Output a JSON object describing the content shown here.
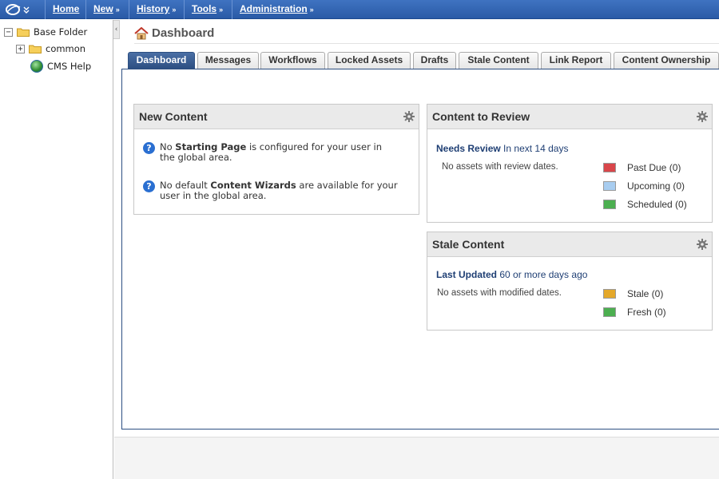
{
  "topbar": {
    "menu": [
      {
        "label": "Home",
        "chevron": false
      },
      {
        "label": "New",
        "chevron": true
      },
      {
        "label": "History",
        "chevron": true
      },
      {
        "label": "Tools",
        "chevron": true
      },
      {
        "label": "Administration",
        "chevron": true
      }
    ]
  },
  "sidebar": {
    "items": [
      {
        "label": "Base Folder",
        "toggle": "−",
        "icon": "folder-icon"
      },
      {
        "label": "common",
        "toggle": "+",
        "icon": "folder-icon"
      },
      {
        "label": "CMS Help",
        "icon": "globe-icon"
      }
    ],
    "collapse_glyph": "‹"
  },
  "page": {
    "title": "Dashboard"
  },
  "tabs": [
    {
      "label": "Dashboard",
      "active": true
    },
    {
      "label": "Messages"
    },
    {
      "label": "Workflows"
    },
    {
      "label": "Locked Assets"
    },
    {
      "label": "Drafts"
    },
    {
      "label": "Stale Content"
    },
    {
      "label": "Link Report"
    },
    {
      "label": "Content Ownership"
    }
  ],
  "widgets": {
    "new_content": {
      "title": "New Content",
      "lines": [
        {
          "pre": "No ",
          "bold": "Starting Page",
          "post": " is configured for your user in the global area."
        },
        {
          "pre": "No default ",
          "bold": "Content Wizards",
          "post": " are available for your user in the global area."
        }
      ]
    },
    "content_to_review": {
      "title": "Content to Review",
      "sub_bold": "Needs Review",
      "sub_rest": " In next 14 days",
      "empty": "No assets with review dates.",
      "legend": [
        {
          "label": "Past Due (0)",
          "color": "#d9464a"
        },
        {
          "label": "Upcoming (0)",
          "color": "#a8cdf0"
        },
        {
          "label": "Scheduled (0)",
          "color": "#4caf50"
        }
      ]
    },
    "stale_content": {
      "title": "Stale Content",
      "sub_bold": "Last Updated",
      "sub_rest": " 60 or more days ago",
      "empty": "No assets with modified dates.",
      "legend": [
        {
          "label": "Stale (0)",
          "color": "#e4a82a"
        },
        {
          "label": "Fresh (0)",
          "color": "#4caf50"
        }
      ]
    }
  },
  "colors": {
    "topbar": "#2f64b3",
    "active_tab": "#2d4f82",
    "link_text": "#1f3f74"
  }
}
